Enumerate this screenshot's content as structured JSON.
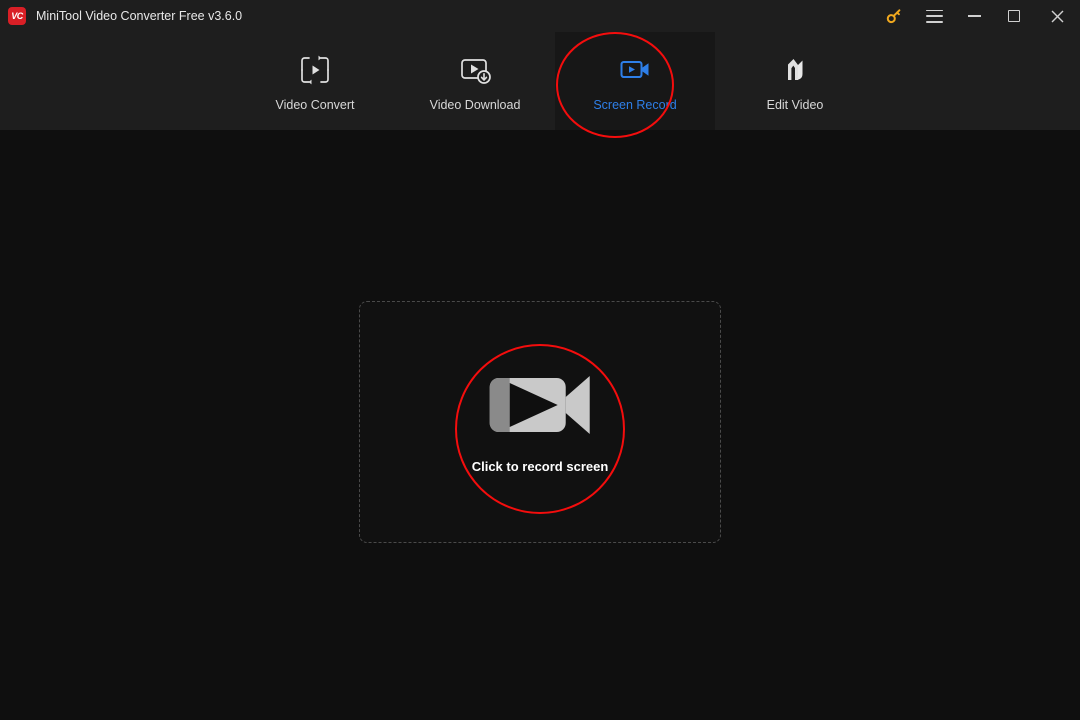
{
  "window": {
    "title": "MiniTool Video Converter Free v3.6.0",
    "logo_text": "VC",
    "controls": [
      {
        "name": "key-icon",
        "label": "Register / License"
      },
      {
        "name": "hamburger-icon",
        "label": "Menu"
      },
      {
        "name": "minimize-icon",
        "label": "Minimize"
      },
      {
        "name": "maximize-icon",
        "label": "Maximize"
      },
      {
        "name": "close-icon",
        "label": "Close"
      }
    ]
  },
  "nav": {
    "tabs": [
      {
        "label": "Video Convert",
        "icon": "video-convert-icon",
        "active": false
      },
      {
        "label": "Video Download",
        "icon": "video-download-icon",
        "active": false
      },
      {
        "label": "Screen Record",
        "icon": "screen-record-icon",
        "active": true
      },
      {
        "label": "Edit Video",
        "icon": "edit-video-icon",
        "active": false
      }
    ],
    "active_tab": "Screen Record"
  },
  "main": {
    "record_caption": "Click to record screen",
    "record_icon": "camcorder-icon"
  },
  "colors": {
    "titlebar_bg": "#1e1e1e",
    "body_bg": "#0f0f0f",
    "active_tab_bg": "#171717",
    "accent_blue": "#2e7fe8",
    "annotation_red": "#f40d0d",
    "logo_red": "#d91f26",
    "key_gold": "#f0a81e",
    "camcorder_light": "#c9c9c9",
    "camcorder_dark": "#8a8a8a",
    "dashed_border": "#4a4a4a"
  }
}
